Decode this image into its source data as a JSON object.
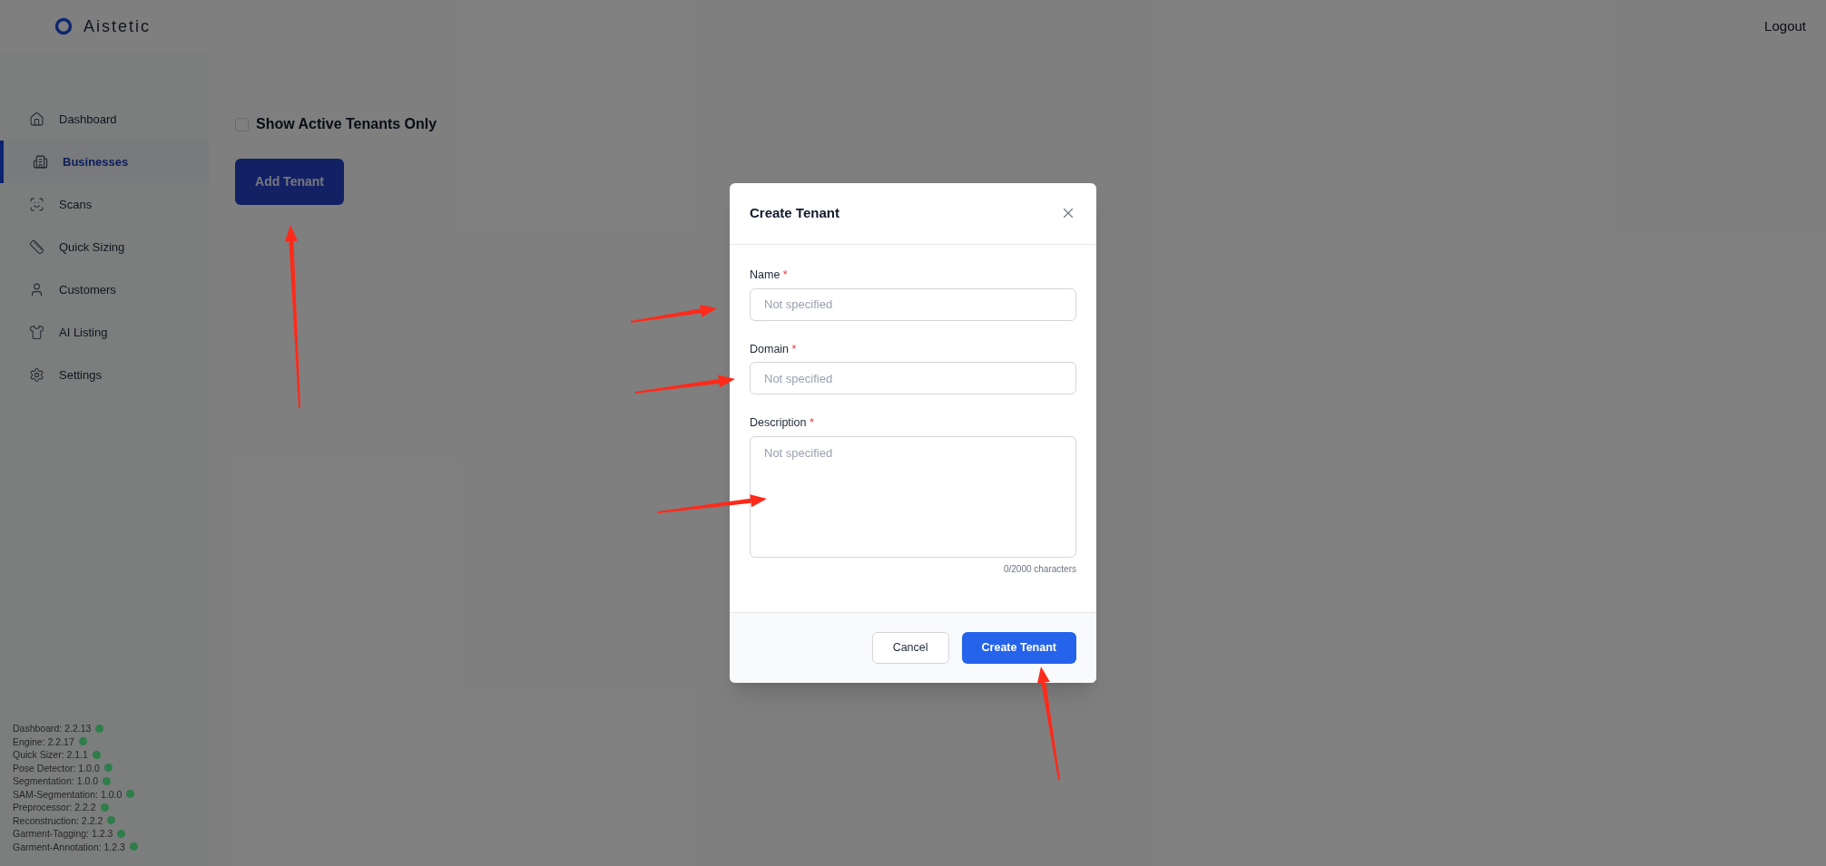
{
  "header": {
    "logo_text": "Aistetic",
    "logout": "Logout"
  },
  "sidebar": {
    "items": [
      {
        "label": "Dashboard",
        "selected": false
      },
      {
        "label": "Businesses",
        "selected": true
      },
      {
        "label": "Scans",
        "selected": false
      },
      {
        "label": "Quick Sizing",
        "selected": false
      },
      {
        "label": "Customers",
        "selected": false
      },
      {
        "label": "AI Listing",
        "selected": false
      },
      {
        "label": "Settings",
        "selected": false
      }
    ],
    "versions": [
      {
        "text": "Dashboard: 2.2.13",
        "color": "#2e7d4a"
      },
      {
        "text": "Engine: 2.2.17",
        "color": "#2e7d4a"
      },
      {
        "text": "Quick Sizer: 2.1.1",
        "color": "#2e7d4a"
      },
      {
        "text": "Pose Detector: 1.0.0",
        "color": "#2e7d4a"
      },
      {
        "text": "Segmentation: 1.0.0",
        "color": "#2e7d4a"
      },
      {
        "text": "SAM-Segmentation: 1.0.0",
        "color": "#2e7d4a"
      },
      {
        "text": "Preprocessor: 2.2.2",
        "color": "#2e7d4a"
      },
      {
        "text": "Reconstruction: 2.2.2",
        "color": "#2e7d4a"
      },
      {
        "text": "Garment-Tagging: 1.2.3",
        "color": "#2e7d4a"
      },
      {
        "text": "Garment-Annotation: 1.2.3",
        "color": "#2e7d4a"
      }
    ]
  },
  "main": {
    "filter": {
      "label": "Show Active Tenants Only",
      "checked": false
    },
    "add_button": "Add Tenant"
  },
  "modal": {
    "title": "Create Tenant",
    "fields": [
      {
        "kind": "input",
        "label": "Name",
        "required_mark": "*",
        "placeholder": "Not specified"
      },
      {
        "kind": "input",
        "label": "Domain",
        "required_mark": "*",
        "placeholder": "Not specified"
      },
      {
        "kind": "textarea",
        "label": "Description",
        "required_mark": "*",
        "placeholder": "Not specified",
        "counter": "0/2000 characters"
      }
    ],
    "buttons": [
      {
        "label": "Cancel",
        "kind": "secondary"
      },
      {
        "label": "Create Tenant",
        "kind": "primary"
      }
    ]
  }
}
